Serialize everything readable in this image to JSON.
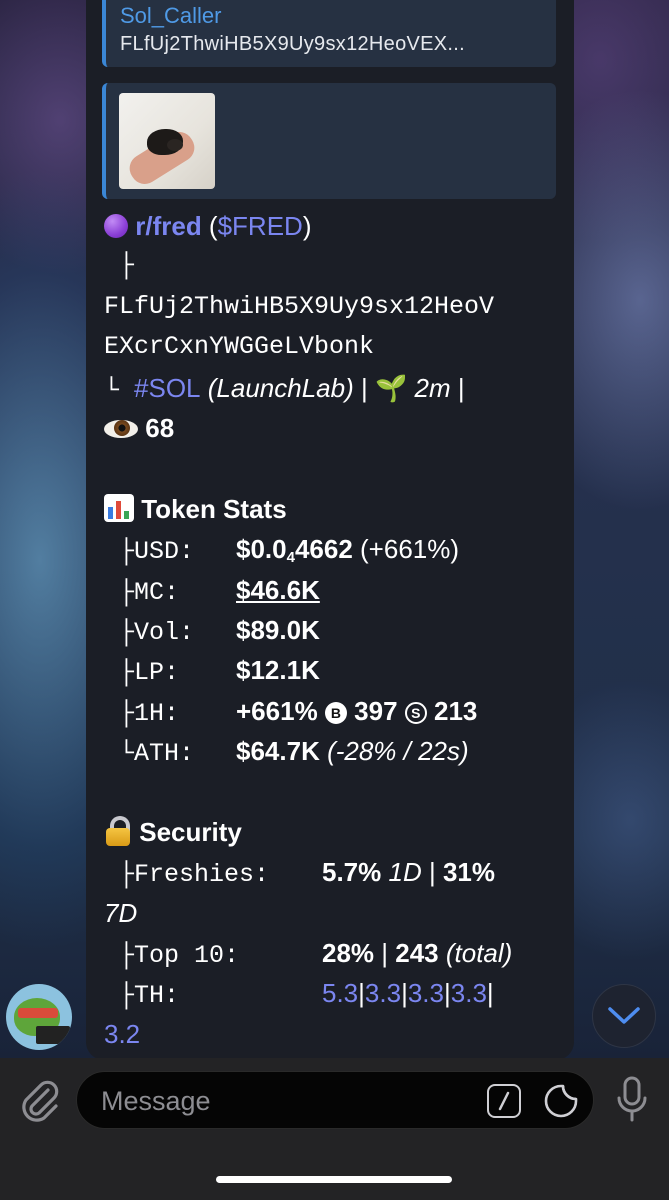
{
  "reply": {
    "name": "Sol_Caller",
    "text": "FLfUj2ThwiHB5X9Uy9sx12HeoVEX..."
  },
  "token": {
    "name": "r/fred",
    "ticker_open": " (",
    "ticker": "$FRED",
    "ticker_close": ")",
    "branch": "├",
    "address_line1": "FLfUj2ThwiHB5X9Uy9sx12HeoV",
    "address_line2": "EXcrCxnYWGGeLVbonk",
    "chain_prefix": " └ ",
    "chain": "#SOL",
    "platform": " (LaunchLab)",
    "sep1": " | ",
    "sprout_icon": "🌱",
    "age": " 2m",
    "sep2": " |",
    "views": "68"
  },
  "stats": {
    "heading": "Token Stats",
    "rows": {
      "usd": {
        "key": "USD:",
        "val_a": "$0.0",
        "val_sub": "4",
        "val_b": "4662",
        "change": " (+661%)"
      },
      "mc": {
        "key": "MC:",
        "val": "$46.6K"
      },
      "vol": {
        "key": "Vol:",
        "val": "$89.0K"
      },
      "lp": {
        "key": "LP:",
        "val": "$12.1K"
      },
      "h1": {
        "key": "1H:",
        "change": "+661%",
        "buy_icon": "B",
        "buys": "397",
        "sell_icon": "S",
        "sells": "213"
      },
      "ath": {
        "key": "ATH:",
        "val": "$64.7K",
        "note": " (-28% / 22s)"
      }
    }
  },
  "security": {
    "heading": "Security",
    "freshies": {
      "key": "Freshies:",
      "v1": "5.7%",
      "p1": " 1D",
      "sep": " | ",
      "v2": "31%",
      "p2": "7D"
    },
    "top10": {
      "key": "Top 10:",
      "v1": "28%",
      "sep": " | ",
      "v2": "243",
      "note": " (total)"
    },
    "th": {
      "key": "TH:",
      "values": [
        "5.3",
        "3.3",
        "3.3",
        "3.3",
        "3.2"
      ]
    }
  },
  "composer": {
    "placeholder": "Message"
  },
  "icons": {
    "purple_dot": "purple-circle-icon",
    "chart": "bar-chart-icon",
    "lock": "lock-icon",
    "eye": "eye-icon",
    "sprout": "seedling-icon",
    "attach": "paperclip-icon",
    "commands": "slash-command-icon",
    "sticker": "sticker-icon",
    "mic": "microphone-icon",
    "scroll": "chevron-down-icon"
  },
  "colors": {
    "link": "#7b86f0",
    "reply_accent": "#3b87d6",
    "bubble": "#1b1e26"
  }
}
